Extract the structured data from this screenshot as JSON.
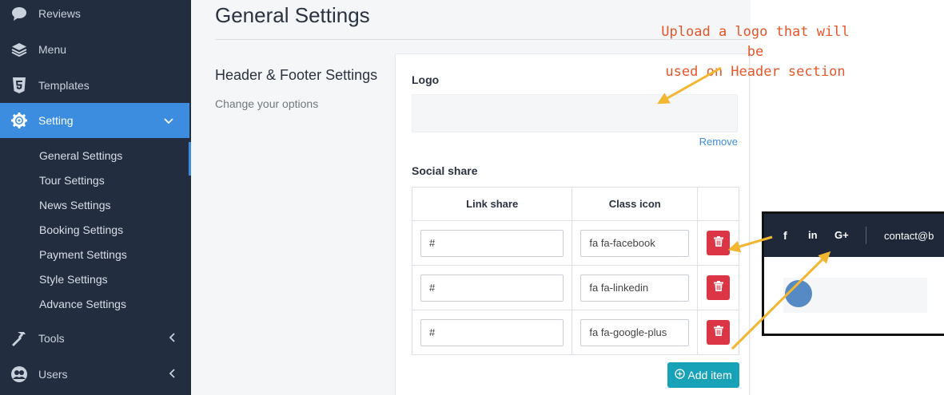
{
  "sidebar": {
    "items": [
      {
        "label": "Reviews",
        "icon": "speech-bubble-icon"
      },
      {
        "label": "Menu",
        "icon": "layers-icon"
      },
      {
        "label": "Templates",
        "icon": "html5-icon"
      },
      {
        "label": "Setting",
        "icon": "gear-icon"
      },
      {
        "label": "Tools",
        "icon": "hammer-icon"
      },
      {
        "label": "Users",
        "icon": "users-icon"
      }
    ],
    "submenu": [
      "General Settings",
      "Tour Settings",
      "News Settings",
      "Booking Settings",
      "Payment Settings",
      "Style Settings",
      "Advance Settings"
    ],
    "active_color": "#3c8de0",
    "bg_color": "#222d3f"
  },
  "page": {
    "title": "General Settings",
    "section_title": "Header & Footer Settings",
    "section_subtitle": "Change your options"
  },
  "form": {
    "logo_label": "Logo",
    "remove_label": "Remove",
    "social_label": "Social share",
    "columns": [
      "Link share",
      "Class icon"
    ],
    "rows": [
      {
        "link": "#",
        "icon_class": "fa fa-facebook"
      },
      {
        "link": "#",
        "icon_class": "fa fa-linkedin"
      },
      {
        "link": "#",
        "icon_class": "fa fa-google-plus"
      }
    ],
    "add_label": "Add item"
  },
  "annotation": {
    "line1": "Upload a logo that will be",
    "line2": "used on  Header section",
    "color": "#e8552a"
  },
  "preview": {
    "social": [
      "f",
      "in",
      "G+"
    ],
    "contact": "contact@b"
  }
}
